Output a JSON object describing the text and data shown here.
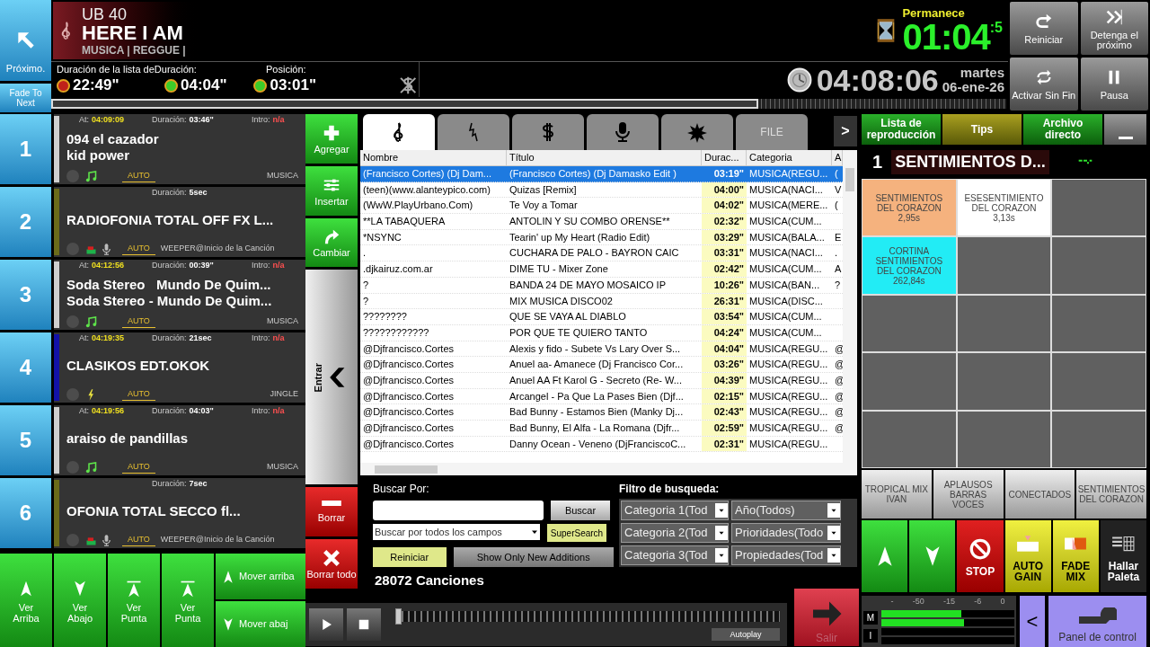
{
  "header": {
    "next_button": "Próximo.",
    "fade_button": "Fade To Next",
    "now_playing": {
      "artist": "UB 40",
      "title": "HERE I AM",
      "category": "MUSICA | REGGUE |"
    },
    "durations": {
      "labels": [
        "Duración de la lista deDuración:",
        "Posición:"
      ],
      "values": [
        {
          "value": "22:49\"",
          "color": "#c0201a"
        },
        {
          "value": "04:04\"",
          "color": "#3ccc2a"
        },
        {
          "value": "03:01\"",
          "color": "#3ccc2a"
        }
      ]
    },
    "remaining": {
      "label": "Permanece",
      "value": "01:04",
      "fraction": ":5"
    },
    "clock": {
      "time": "04:08:06",
      "day": "martes",
      "date": "06-ene-26"
    },
    "progress": {
      "level": 0.74
    },
    "controls": [
      {
        "kind": "restart",
        "label": "Reiniciar"
      },
      {
        "kind": "skip",
        "label": "Detenga el próximo"
      },
      {
        "kind": "loop",
        "label": "Activar Sin Fin"
      },
      {
        "kind": "pause",
        "label": "Pausa"
      }
    ]
  },
  "playlist": [
    {
      "number": "1",
      "kind": "music",
      "at": {
        "label": "At:",
        "value": "04:09:09"
      },
      "duration": {
        "label": "Duración:",
        "value": "03:46\""
      },
      "intro": {
        "label": "Intro:",
        "value": "n/a"
      },
      "lines": [
        "094 el cazador",
        "kid power"
      ],
      "auto": "AUTO",
      "category": "MUSICA",
      "color": "#cfcfcf"
    },
    {
      "number": "2",
      "kind": "voice",
      "duration": {
        "label": "Duración:",
        "value": "5sec"
      },
      "lines": [
        "RADIOFONIA TOTAL OFF FX L..."
      ],
      "auto": "AUTO",
      "info": "WEEPER@Inicio de la Canción",
      "color": "#6b6b1a"
    },
    {
      "number": "3",
      "kind": "music",
      "at": {
        "label": "At:",
        "value": "04:12:56"
      },
      "duration": {
        "label": "Duración:",
        "value": "00:39\""
      },
      "intro": {
        "label": "Intro:",
        "value": "n/a"
      },
      "lines": [
        "Soda Stereo   Mundo De Quim...",
        "Soda Stereo - Mundo De Quim..."
      ],
      "auto": "AUTO",
      "category": "MUSICA",
      "color": "#cfcfcf"
    },
    {
      "number": "4",
      "kind": "jingle",
      "at": {
        "label": "At:",
        "value": "04:19:35"
      },
      "duration": {
        "label": "Duración:",
        "value": "21sec"
      },
      "intro": {
        "label": "Intro:",
        "value": "n/a"
      },
      "lines": [
        "CLASIKOS EDT.OKOK"
      ],
      "auto": "AUTO",
      "category": "JINGLE",
      "color": "#1212a8"
    },
    {
      "number": "5",
      "kind": "music",
      "at": {
        "label": "At:",
        "value": "04:19:56"
      },
      "duration": {
        "label": "Duración:",
        "value": "04:03\""
      },
      "intro": {
        "label": "Intro:",
        "value": "n/a"
      },
      "lines": [
        "araiso de pandillas"
      ],
      "auto": "AUTO",
      "category": "MUSICA",
      "color": "#cfcfcf"
    },
    {
      "number": "6",
      "kind": "voice",
      "duration": {
        "label": "Duración:",
        "value": "7sec"
      },
      "lines": [
        "OFONIA TOTAL SECCO fl..."
      ],
      "auto": "AUTO",
      "info": "WEEPER@Inicio de la Canción",
      "color": "#6b6b1a"
    }
  ],
  "view_buttons": [
    {
      "kind": "up",
      "label": "Ver Arriba"
    },
    {
      "kind": "down",
      "label": "Ver Abajo"
    },
    {
      "kind": "top",
      "label": "Ver Punta"
    },
    {
      "kind": "top",
      "label": "Ver Punta"
    }
  ],
  "move_buttons": [
    {
      "kind": "up",
      "label": "Mover arriba"
    },
    {
      "kind": "down",
      "label": "Mover abaj"
    }
  ],
  "side_buttons": [
    {
      "kind": "add",
      "label": "Agregar"
    },
    {
      "kind": "insert",
      "label": "Insertar"
    },
    {
      "kind": "change",
      "label": "Cambiar"
    },
    {
      "kind": "enter",
      "label": "Entrar"
    },
    {
      "kind": "delete",
      "label": "Borrar"
    },
    {
      "kind": "clear",
      "label": "Borrar todo"
    }
  ],
  "library": {
    "tabs": [
      {
        "kind": "clef",
        "selected": true
      },
      {
        "kind": "bolt",
        "selected": false
      },
      {
        "kind": "dollar",
        "selected": false
      },
      {
        "kind": "mic",
        "selected": false
      },
      {
        "kind": "burst",
        "selected": false
      },
      {
        "kind": "text",
        "label": "FILE",
        "selected": false
      }
    ],
    "more_button": ">",
    "columns": [
      "Nombre",
      "Título",
      "Durac...",
      "Categoria",
      "A"
    ],
    "rows": [
      {
        "cells": [
          "(Francisco Cortes) (Dj Dam...",
          "(Francisco Cortes) (Dj Damasko Edit )",
          "03:19\"",
          "MUSICA(REGU...",
          "("
        ],
        "selected": true
      },
      {
        "cells": [
          "(teen)(www.alanteypico.com)",
          "Quizas [Remix]",
          "04:00\"",
          "MUSICA(NACI...",
          "V"
        ],
        "selected": false
      },
      {
        "cells": [
          "(WwW.PlayUrbano.Com)",
          "Te Voy a Tomar",
          "04:02\"",
          "MUSICA(MERE...",
          "("
        ],
        "selected": false
      },
      {
        "cells": [
          "**LA TABAQUERA",
          "ANTOLIN Y SU COMBO ORENSE**",
          "02:32\"",
          "MUSICA(CUM..."
        ],
        "selected": false
      },
      {
        "cells": [
          "*NSYNC",
          "Tearin' up My Heart (Radio Edit)",
          "03:29\"",
          "MUSICA(BALA...",
          "E"
        ],
        "selected": false
      },
      {
        "cells": [
          ".",
          "CUCHARA DE PALO - BAYRON CAIC",
          "03:31\"",
          "MUSICA(NACI...",
          "."
        ],
        "selected": false
      },
      {
        "cells": [
          ".djkairuz.com.ar",
          "DIME TU - Mixer Zone",
          "02:42\"",
          "MUSICA(CUM...",
          "A"
        ],
        "selected": false
      },
      {
        "cells": [
          "?",
          "BANDA 24 DE MAYO MOSAICO IP",
          "10:26\"",
          "MUSICA(BAN...",
          "?"
        ],
        "selected": false
      },
      {
        "cells": [
          "?",
          "MIX MUSICA DISCO02",
          "26:31\"",
          "MUSICA(DISC..."
        ],
        "selected": false
      },
      {
        "cells": [
          "????????",
          "QUE SE VAYA AL DIABLO",
          "03:54\"",
          "MUSICA(CUM..."
        ],
        "selected": false
      },
      {
        "cells": [
          "????????????",
          "POR QUE TE QUIERO TANTO",
          "04:24\"",
          "MUSICA(CUM..."
        ],
        "selected": false
      },
      {
        "cells": [
          "@Djfrancisco.Cortes",
          "Alexis y fido - Subete Vs Lary Over S...",
          "04:04\"",
          "MUSICA(REGU...",
          "@"
        ],
        "selected": false
      },
      {
        "cells": [
          "@Djfrancisco.Cortes",
          "Anuel aa- Amanece (Dj Francisco Cor...",
          "03:26\"",
          "MUSICA(REGU...",
          "@"
        ],
        "selected": false
      },
      {
        "cells": [
          "@Djfrancisco.Cortes",
          "Anuel AA Ft Karol G - Secreto (Re- W...",
          "04:39\"",
          "MUSICA(REGU...",
          "@"
        ],
        "selected": false
      },
      {
        "cells": [
          "@Djfrancisco.Cortes",
          "Arcangel - Pa Que La Pases Bien (Djf...",
          "02:15\"",
          "MUSICA(REGU...",
          "@"
        ],
        "selected": false
      },
      {
        "cells": [
          "@Djfrancisco.Cortes",
          "Bad Bunny - Estamos Bien (Manky Dj...",
          "02:43\"",
          "MUSICA(REGU...",
          "@"
        ],
        "selected": false
      },
      {
        "cells": [
          "@Djfrancisco.Cortes",
          "Bad Bunny, El Alfa - La Romana (Djfr...",
          "02:59\"",
          "MUSICA(REGU...",
          "@"
        ],
        "selected": false
      },
      {
        "cells": [
          "@Djfrancisco.Cortes",
          "Danny Ocean - Veneno (DjFranciscoC...",
          "02:31\"",
          "MUSICA(REGU..."
        ],
        "selected": false
      }
    ],
    "search": {
      "label": "Buscar Por:",
      "button": "Buscar",
      "field_select": "Buscar por todos los campos",
      "supersearch": "SuperSearch",
      "reset": "Reiniciar",
      "new_additions": "Show Only New Additions",
      "filter_label": "Filtro de busqueda:",
      "filters": [
        "Categoria 1(Tod",
        "Año(Todos)",
        "Categoria 2(Tod",
        "Prioridades(Todo",
        "Categoria 3(Tod",
        "Propiedades(Tod"
      ]
    },
    "count": "28072 Canciones"
  },
  "player": {
    "level": 0.0,
    "autoplay": "Autoplay",
    "exit": "Salir"
  },
  "right": {
    "tabs": [
      {
        "label": "Lista de reproducción",
        "selected": false
      },
      {
        "label": "Tips",
        "selected": true
      },
      {
        "label": "Archivo directo",
        "selected": false
      }
    ],
    "cart_number": "1",
    "cart_title": "SENTIMIENTOS D...",
    "carts": [
      {
        "lines": [
          "SENTIMIENTOS",
          "DEL CORAZON",
          "2,95s"
        ],
        "color": "#f5b27e"
      },
      {
        "lines": [
          "ESESENTIMIENTO",
          "DEL CORAZON",
          "3,13s"
        ],
        "color": "#ffffff"
      },
      {
        "color": "#606060"
      },
      {
        "lines": [
          "CORTINA",
          "SENTIMIENTOS",
          "DEL CORAZON",
          "262,84s"
        ],
        "color": "#22ecf5"
      },
      {
        "color": "#606060"
      },
      {
        "color": "#606060"
      },
      {
        "color": "#606060"
      },
      {
        "color": "#606060"
      },
      {
        "color": "#606060"
      },
      {
        "color": "#606060"
      },
      {
        "color": "#606060"
      },
      {
        "color": "#606060"
      },
      {
        "color": "#606060"
      },
      {
        "color": "#606060"
      },
      {
        "color": "#606060"
      }
    ],
    "quick": [
      "TROPICAL MIX IVAN",
      "APLAUSOS BARRAS VOCES",
      "CONECTADOS",
      "SENTIMIENTOS DEL CORAZON"
    ],
    "actions": [
      {
        "kind": "up"
      },
      {
        "kind": "down"
      },
      {
        "kind": "stop",
        "label": "STOP"
      },
      {
        "kind": "gain",
        "label": "AUTO GAIN"
      },
      {
        "kind": "fade",
        "label": "FADE MIX"
      },
      {
        "kind": "palette",
        "label": "Hallar Paleta"
      }
    ],
    "meter": {
      "scale": [
        "-",
        "-50",
        "-15",
        "-6",
        "0"
      ],
      "rows": [
        {
          "label": "M",
          "bars": [
            {
              "level": 0.6
            },
            {
              "level": 0.62
            }
          ]
        },
        {
          "label": "I",
          "bars": [
            {
              "level": 0
            },
            {
              "level": 0
            }
          ]
        }
      ]
    },
    "back_button": "<",
    "panel_button": "Panel de control"
  }
}
